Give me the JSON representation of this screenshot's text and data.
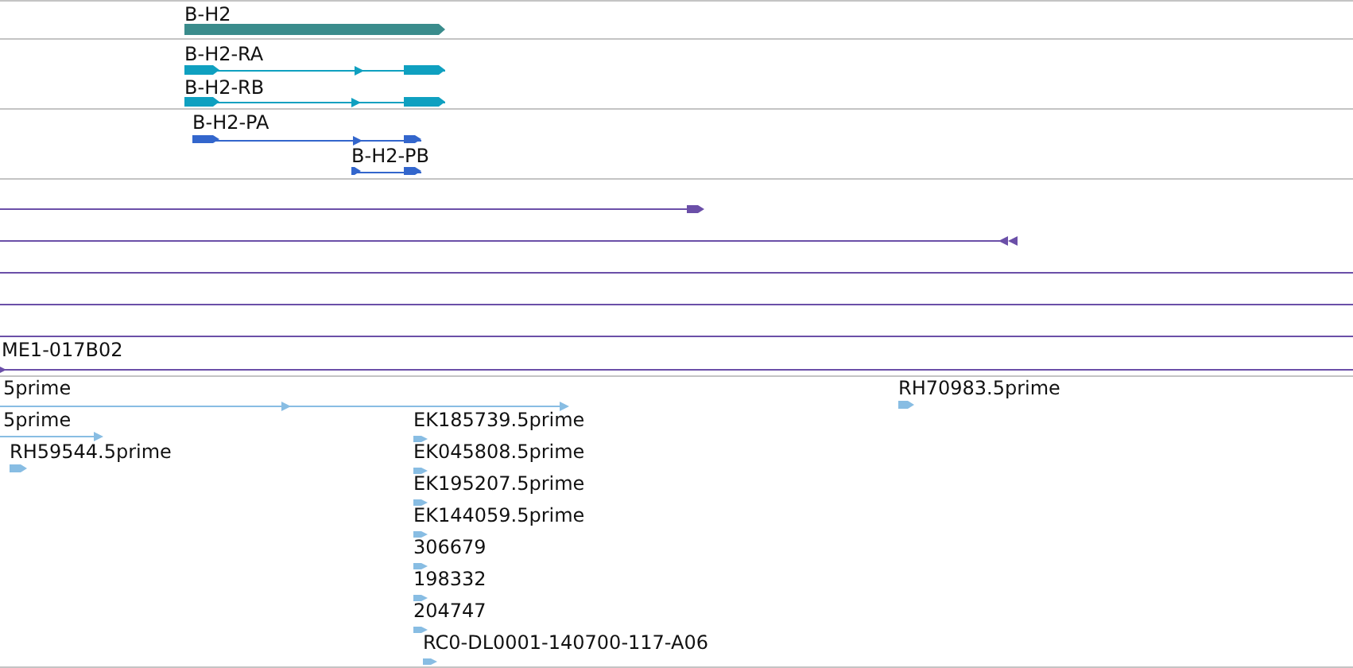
{
  "tracks": [
    {
      "features": [
        {
          "label": "B-H2"
        }
      ]
    },
    {
      "features": [
        {
          "label": "B-H2-RA"
        },
        {
          "label": "B-H2-RB"
        }
      ]
    },
    {
      "features": [
        {
          "label": "B-H2-PA"
        },
        {
          "label": "B-H2-PB"
        }
      ]
    },
    {
      "features": [
        {
          "label": "ME1-017B02"
        }
      ]
    },
    {
      "features": [
        {
          "label": "5prime"
        },
        {
          "label": "RH70983.5prime"
        },
        {
          "label": "5prime"
        },
        {
          "label": "RH59544.5prime"
        },
        {
          "label": "EK185739.5prime"
        },
        {
          "label": "EK045808.5prime"
        },
        {
          "label": "EK195207.5prime"
        },
        {
          "label": "EK144059.5prime"
        },
        {
          "label": "306679"
        },
        {
          "label": "198332"
        },
        {
          "label": "204747"
        },
        {
          "label": "RC0-DL0001-140700-117-A06"
        }
      ]
    }
  ]
}
